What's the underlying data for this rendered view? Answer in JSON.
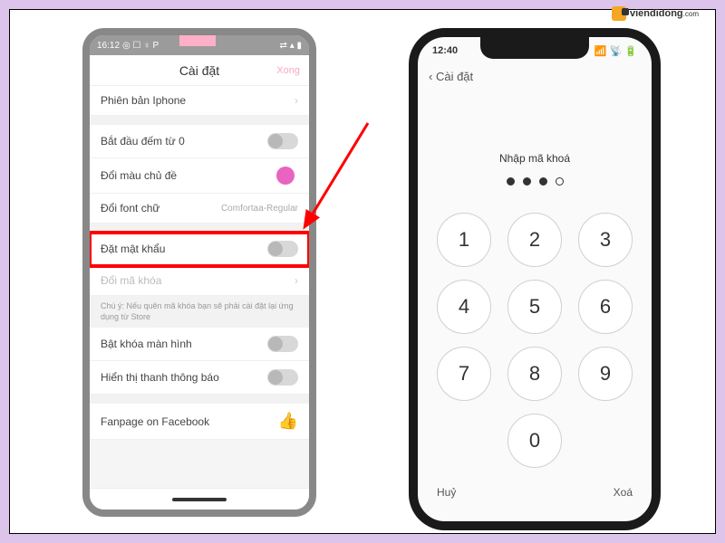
{
  "watermark": {
    "text": "viendidong",
    "sub": ".com"
  },
  "android": {
    "status": {
      "time": "16:12",
      "icons_left": "◎ ☐ ♀ P",
      "icons_right": "⇄ ▴ ▮"
    },
    "header": {
      "title": "Cài đặt",
      "done": "Xong"
    },
    "rows": {
      "version": "Phiên bản Iphone",
      "count_zero": "Bắt đầu đếm từ 0",
      "theme_color": "Đổi màu chủ đề",
      "font": "Đổi font chữ",
      "font_value": "Comfortaa-Regular",
      "password": "Đặt mật khẩu",
      "change_code": "Đổi mã khóa",
      "note": "Chú ý: Nếu quên mã khóa bạn sẽ phải cài đặt lại ứng dụng từ Store",
      "screenlock": "Bật khóa màn hình",
      "notif_bar": "Hiển thị thanh thông báo",
      "fanpage": "Fanpage on Facebook"
    }
  },
  "iphone": {
    "status": {
      "time": "12:40"
    },
    "back": "Cài đặt",
    "prompt": "Nhập mã khoá",
    "filled_dots": 3,
    "total_dots": 4,
    "keys": [
      "1",
      "2",
      "3",
      "4",
      "5",
      "6",
      "7",
      "8",
      "9",
      "0"
    ],
    "cancel": "Huỷ",
    "delete": "Xoá"
  }
}
